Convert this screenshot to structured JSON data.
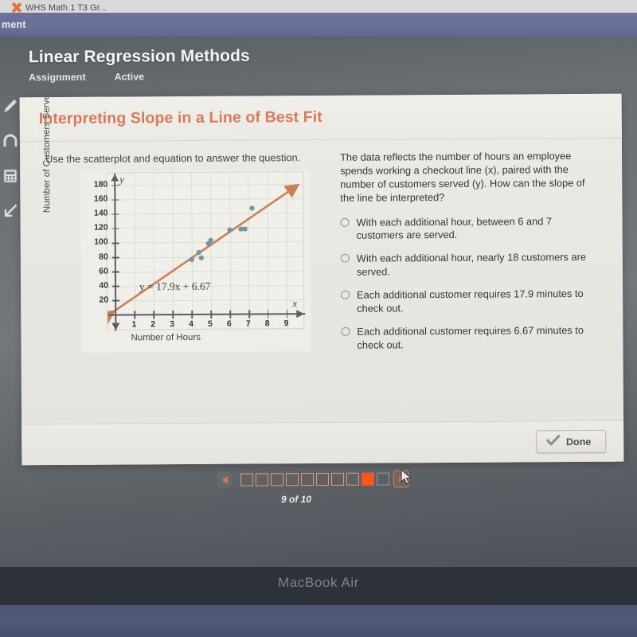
{
  "browser": {
    "tab_title": "WHS Math 1 T3 Gr...",
    "tab_icon": "x-close-icon",
    "purple_bar_text": "ment"
  },
  "device": {
    "label": "MacBook Air"
  },
  "toolbar": {
    "icons": [
      "pencil-icon",
      "magnet-icon",
      "calculator-icon",
      "arrow-tool-icon"
    ]
  },
  "lesson": {
    "title": "Linear Regression Methods",
    "type_label": "Assignment",
    "status_label": "Active"
  },
  "card": {
    "banner_title": "Interpreting Slope in a Line of Best Fit",
    "prompt": "Use the scatterplot and equation to answer the question.",
    "question": "The data reflects the number of hours an employee spends working a checkout line (x), paired with the number of customers served (y). How can the slope of the line be interpreted?",
    "choices": [
      {
        "id": "a",
        "text": "With each additional hour, between 6 and 7 customers are served.",
        "selected": false
      },
      {
        "id": "b",
        "text": "With each additional hour, nearly 18 customers are served.",
        "selected": false
      },
      {
        "id": "c",
        "text": "Each additional customer requires 17.9 minutes to check out.",
        "selected": false
      },
      {
        "id": "d",
        "text": "Each additional customer requires 6.67 minutes to check out.",
        "selected": false
      }
    ],
    "done_label": "Done"
  },
  "pager": {
    "prev_label": "◀",
    "next_label": "▶",
    "count_text": "9 of 10",
    "total": 10,
    "current": 9,
    "pages": [
      {
        "n": 1,
        "state": "visited"
      },
      {
        "n": 2,
        "state": "visited"
      },
      {
        "n": 3,
        "state": "visited"
      },
      {
        "n": 4,
        "state": "visited"
      },
      {
        "n": 5,
        "state": "visited"
      },
      {
        "n": 6,
        "state": "visited"
      },
      {
        "n": 7,
        "state": "visited"
      },
      {
        "n": 8,
        "state": "visited"
      },
      {
        "n": 9,
        "state": "current"
      },
      {
        "n": 10,
        "state": "unvisited"
      }
    ]
  },
  "colors": {
    "accent_orange": "#d87b58",
    "pager_current": "#f4581f",
    "regression_line": "#cc8055",
    "point": "#6d98a4",
    "purple_bar": "#6c719c"
  },
  "chart_data": {
    "type": "scatter",
    "title": "",
    "xlabel": "Number of Hours",
    "ylabel": "Number of Customers Served",
    "x_var": "x",
    "y_var": "y",
    "xlim": [
      0,
      9.7
    ],
    "ylim": [
      0,
      190
    ],
    "xticks": [
      1,
      2,
      3,
      4,
      5,
      6,
      7,
      8,
      9
    ],
    "yticks": [
      20,
      40,
      60,
      80,
      100,
      120,
      140,
      160,
      180
    ],
    "grid": true,
    "equation_text": "y = 17.9x + 6.67",
    "slope": 17.9,
    "intercept": 6.67,
    "points": [
      {
        "x": 4.0,
        "y": 76
      },
      {
        "x": 4.4,
        "y": 86
      },
      {
        "x": 4.5,
        "y": 78
      },
      {
        "x": 4.9,
        "y": 98
      },
      {
        "x": 5.0,
        "y": 103
      },
      {
        "x": 6.0,
        "y": 117
      },
      {
        "x": 6.6,
        "y": 118
      },
      {
        "x": 6.8,
        "y": 118
      },
      {
        "x": 7.2,
        "y": 147
      }
    ]
  }
}
